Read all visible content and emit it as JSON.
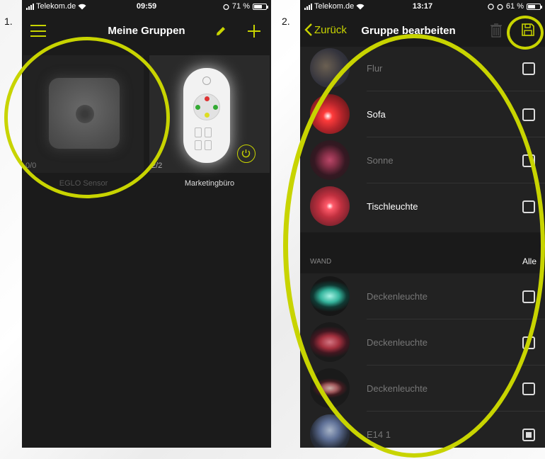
{
  "labels": {
    "step1": "1.",
    "step2": "2."
  },
  "phone1": {
    "status": {
      "carrier": "Telekom.de",
      "time": "09:59",
      "battery": "71 %",
      "battery_level": 0.71
    },
    "title": "Meine Gruppen",
    "tiles": [
      {
        "name": "EGLO Sensor",
        "count": "0/0"
      },
      {
        "name": "Marketingbüro",
        "count": "2/2"
      }
    ],
    "icons": {
      "menu": "hamburger-icon",
      "edit": "pencil-icon",
      "add": "plus-icon",
      "power": "power-icon"
    }
  },
  "phone2": {
    "status": {
      "carrier": "Telekom.de",
      "time": "13:17",
      "battery": "61 %",
      "battery_level": 0.61
    },
    "back_label": "Zurück",
    "title": "Gruppe bearbeiten",
    "items_top": [
      {
        "label": "Flur",
        "checked": false,
        "dim": true
      },
      {
        "label": "Sofa",
        "checked": false,
        "dim": false
      },
      {
        "label": "Sonne",
        "checked": false,
        "dim": true
      },
      {
        "label": "Tischleuchte",
        "checked": false,
        "dim": false
      }
    ],
    "section": {
      "title": "WAND",
      "action": "Alle"
    },
    "items_wand": [
      {
        "label": "Deckenleuchte",
        "checked": false,
        "dim": true
      },
      {
        "label": "Deckenleuchte",
        "checked": false,
        "dim": true
      },
      {
        "label": "Deckenleuchte",
        "checked": false,
        "dim": true
      },
      {
        "label": "E14 1",
        "checked": true,
        "dim": true
      }
    ],
    "icons": {
      "back": "chevron-left-icon",
      "delete": "trash-icon",
      "save": "floppy-disk-icon"
    }
  },
  "colors": {
    "accent": "#c8d400",
    "background": "#1c1c1c"
  }
}
